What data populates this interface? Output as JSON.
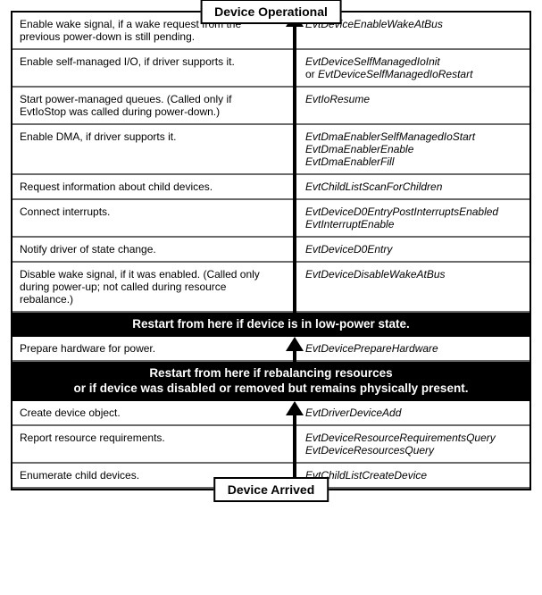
{
  "titles": {
    "top": "Device Operational",
    "bottom": "Device Arrived"
  },
  "bars": {
    "mid1": "Restart from here if device is in low-power state.",
    "mid2": "Restart from here if rebalancing resources\nor if device was disabled or removed but remains physically present."
  },
  "section1": [
    {
      "left": "Enable wake signal, if a wake request from the previous power-down is still pending.",
      "right": [
        "EvtDeviceEnableWakeAtBus"
      ]
    },
    {
      "left": "Enable self-managed I/O, if driver supports it.",
      "right": [
        "EvtDeviceSelfManagedIoInit",
        "or EvtDeviceSelfManagedIoRestart"
      ]
    },
    {
      "left": "Start power-managed queues. (Called only if EvtIoStop was called during power-down.)",
      "right": [
        "EvtIoResume"
      ]
    },
    {
      "left": "Enable DMA, if driver supports it.",
      "right": [
        "EvtDmaEnablerSelfManagedIoStart",
        "EvtDmaEnablerEnable",
        "EvtDmaEnablerFill"
      ]
    },
    {
      "left": "Request information about child devices.",
      "right": [
        "EvtChildListScanForChildren"
      ]
    },
    {
      "left": "Connect interrupts.",
      "right": [
        "EvtDeviceD0EntryPostInterruptsEnabled",
        "EvtInterruptEnable"
      ]
    },
    {
      "left": "Notify driver of state change.",
      "right": [
        "EvtDeviceD0Entry"
      ]
    },
    {
      "left": "Disable wake signal, if it was enabled. (Called only during power-up; not called during resource rebalance.)",
      "right": [
        "EvtDeviceDisableWakeAtBus"
      ]
    }
  ],
  "section2": [
    {
      "left": "Prepare hardware for power.",
      "right": [
        "EvtDevicePrepareHardware"
      ]
    }
  ],
  "section3": [
    {
      "left": "Create device object.",
      "right": [
        "EvtDriverDeviceAdd"
      ]
    },
    {
      "left": "Report resource requirements.",
      "right": [
        "EvtDeviceResourceRequirementsQuery",
        "EvtDeviceResourcesQuery"
      ]
    },
    {
      "left": "Enumerate child devices.",
      "right": [
        "EvtChildListCreateDevice"
      ]
    }
  ]
}
